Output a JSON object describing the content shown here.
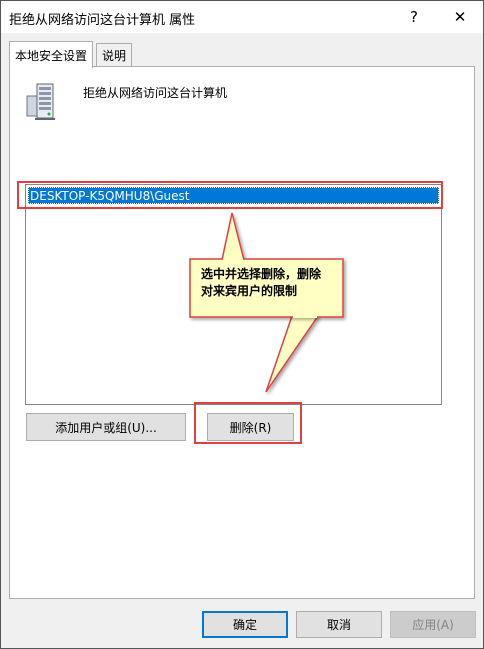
{
  "window": {
    "title": "拒绝从网络访问这台计算机 属性",
    "help_label": "?",
    "close_label": "✕"
  },
  "tabs": [
    {
      "label": "本地安全设置",
      "active": true
    },
    {
      "label": "说明",
      "active": false
    }
  ],
  "policy": {
    "icon": "server-computer-icon",
    "name": "拒绝从网络访问这台计算机"
  },
  "accounts": {
    "items": [
      "DESKTOP-K5QMHU8\\Guest"
    ],
    "selected_index": 0
  },
  "actions": {
    "add_label": "添加用户或组(U)...",
    "remove_label": "删除(R)"
  },
  "annotation": {
    "line1": "选中并选择删除，删除",
    "line2": "对来宾用户的限制",
    "highlight_color": "#e04040",
    "callout_color": "#ffffc4"
  },
  "footer": {
    "ok_label": "确定",
    "cancel_label": "取消",
    "apply_label": "应用(A)"
  },
  "colors": {
    "selection": "#0078d7",
    "dialog_bg": "#f0f0f0"
  }
}
